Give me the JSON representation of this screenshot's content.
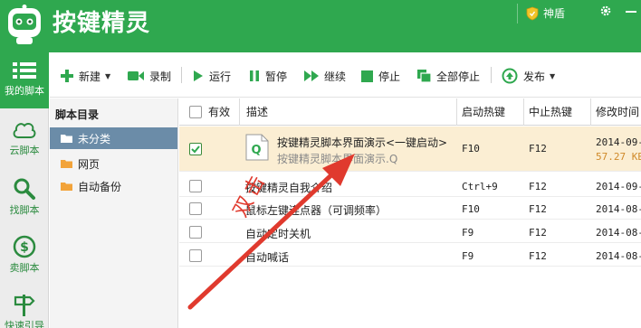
{
  "header": {
    "app_title": "按键精灵",
    "user_name": "神盾",
    "brand_color": "#2fa84f"
  },
  "leftnav": {
    "items": [
      {
        "label": "我的脚本",
        "icon": "list-icon",
        "active": true
      },
      {
        "label": "云脚本",
        "icon": "cloud-icon"
      },
      {
        "label": "找脚本",
        "icon": "search-icon"
      },
      {
        "label": "卖脚本",
        "icon": "dollar-icon"
      },
      {
        "label": "快速引导",
        "icon": "signpost-icon"
      }
    ]
  },
  "toolbar": {
    "new": "新建",
    "record": "录制",
    "run": "运行",
    "pause": "暂停",
    "resume": "继续",
    "stop": "停止",
    "stop_all": "全部停止",
    "publish": "发布"
  },
  "directory": {
    "title": "脚本目录",
    "items": [
      {
        "label": "未分类",
        "selected": true
      },
      {
        "label": "网页"
      },
      {
        "label": "自动备份"
      }
    ]
  },
  "table": {
    "headers": {
      "valid": "有效",
      "desc": "描述",
      "start_hotkey": "启动热键",
      "stop_hotkey": "中止热键",
      "modified": "修改时间"
    },
    "rows": [
      {
        "checked": true,
        "desc": "按键精灵脚本界面演示<一键启动>",
        "file": "按键精灵脚本界面演示.Q",
        "start": "F10",
        "stop": "F12",
        "modified": "2014-09-",
        "size": "57.27 KB",
        "selected": true
      },
      {
        "checked": false,
        "desc": "按键精灵自我介绍",
        "start": "Ctrl+9",
        "stop": "F12",
        "modified": "2014-09-"
      },
      {
        "checked": false,
        "desc": "鼠标左键连点器（可调频率）",
        "start": "F10",
        "stop": "F12",
        "modified": "2014-08-"
      },
      {
        "checked": false,
        "desc": "自动定时关机",
        "start": "F9",
        "stop": "F12",
        "modified": "2014-08-"
      },
      {
        "checked": false,
        "desc": "自动喊话",
        "start": "F9",
        "stop": "F12",
        "modified": "2014-08-"
      }
    ]
  },
  "annotation": {
    "text": "双击",
    "color": "#e03a2e"
  }
}
